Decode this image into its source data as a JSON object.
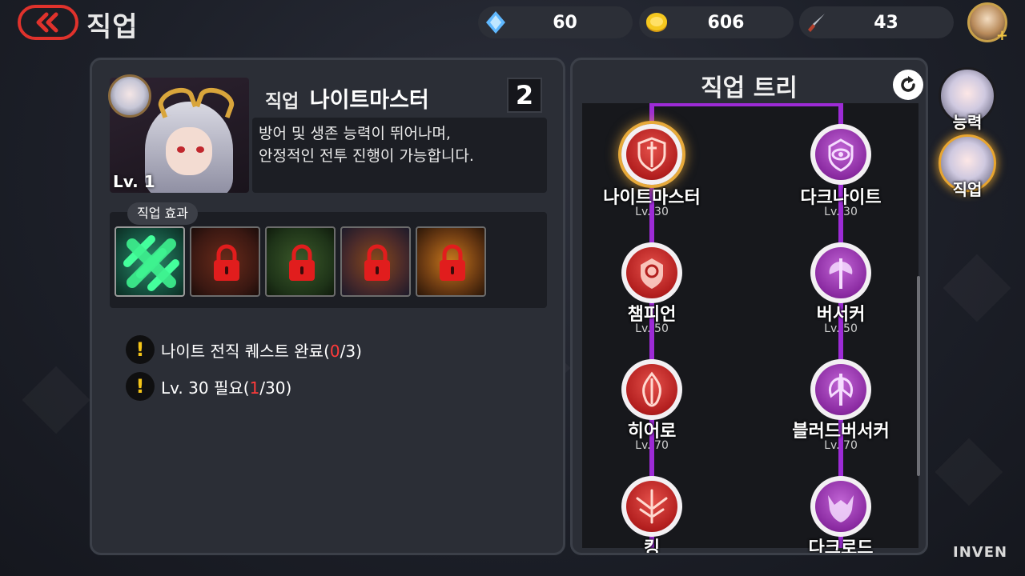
{
  "header": {
    "title": "직업",
    "back_icon": "double-chevron-left-icon"
  },
  "resources": {
    "gem": {
      "icon": "blue-crystal-icon",
      "value": "60"
    },
    "gold": {
      "icon": "gold-coin-icon",
      "value": "606"
    },
    "key": {
      "icon": "dagger-icon",
      "value": "43"
    }
  },
  "job_panel": {
    "portrait_level": "Lv. 1",
    "job_prefix": "직업",
    "job_name": "나이트마스터",
    "rank": "2",
    "description": "방어 및 생존 능력이 뛰어나며,\n안정적인 전투 진행이 가능합니다.",
    "effects_tab": "직업 효과",
    "effects": [
      {
        "name": "green-cross-skill-icon",
        "locked": false
      },
      {
        "name": "locked-skill-icon",
        "locked": true
      },
      {
        "name": "locked-skill-icon",
        "locked": true
      },
      {
        "name": "locked-skill-icon",
        "locked": true
      },
      {
        "name": "locked-skill-icon",
        "locked": true
      }
    ],
    "requirements": [
      {
        "prefix": "나이트 전직 퀘스트 완료(",
        "current": "0",
        "suffix": "/3)"
      },
      {
        "prefix": "Lv. 30 필요(",
        "current": "1",
        "suffix": "/30)"
      }
    ]
  },
  "job_tree": {
    "title": "직업 트리",
    "refresh_icon": "refresh-icon",
    "knight_path": [
      {
        "name": "나이트마스터",
        "level": "Lv. 30",
        "icon": "sword-shield-icon",
        "selected": true
      },
      {
        "name": "챔피언",
        "level": "Lv. 50",
        "icon": "shield-emblem-icon"
      },
      {
        "name": "히어로",
        "level": "Lv. 70",
        "icon": "flame-sword-icon"
      },
      {
        "name": "킹",
        "level": "",
        "icon": "winged-sword-icon"
      }
    ],
    "dark_path": [
      {
        "name": "다크나이트",
        "level": "Lv. 30",
        "icon": "dark-eye-icon"
      },
      {
        "name": "버서커",
        "level": "Lv. 50",
        "icon": "axe-icon"
      },
      {
        "name": "블러드버서커",
        "level": "Lv. 70",
        "icon": "double-axe-icon"
      },
      {
        "name": "다크로드",
        "level": "",
        "icon": "demon-helm-icon"
      }
    ]
  },
  "side_tabs": [
    {
      "label": "능력",
      "active": false
    },
    {
      "label": "직업",
      "active": true
    }
  ],
  "colors": {
    "accent_red": "#e0322c",
    "tree_line": "#9d2bd6",
    "selected_glow": "#e7a93a"
  },
  "watermark": "INVEN"
}
